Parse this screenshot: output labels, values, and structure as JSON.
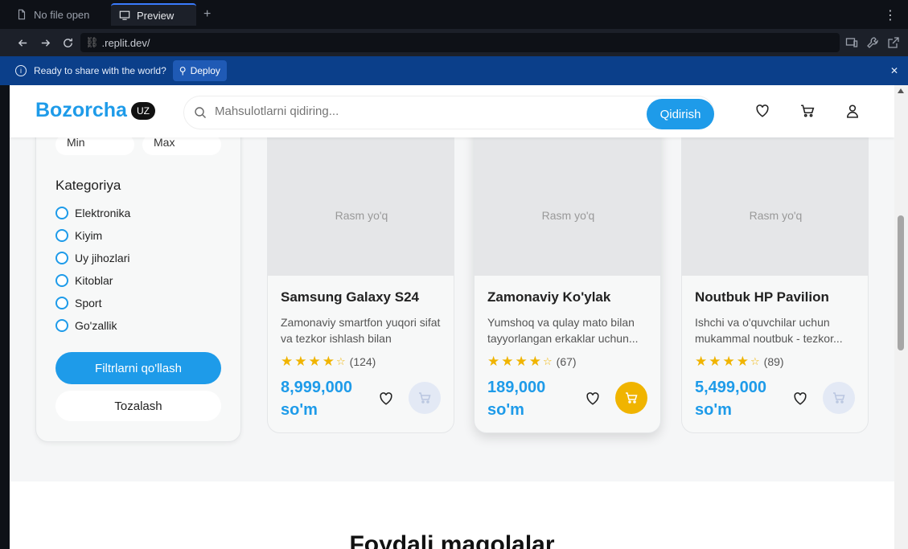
{
  "browser": {
    "tabs": [
      {
        "label": "No file open"
      },
      {
        "label": "Preview"
      }
    ],
    "url": ".replit.dev/"
  },
  "deploy_bar": {
    "message": "Ready to share with the world?",
    "button": "Deploy"
  },
  "header": {
    "logo": "Bozorcha",
    "lang": "UZ",
    "search_placeholder": "Mahsulotlarni qidiring...",
    "search_button": "Qidirish"
  },
  "filters": {
    "min_placeholder": "Min",
    "max_placeholder": "Max",
    "category_title": "Kategoriya",
    "categories": [
      "Elektronika",
      "Kiyim",
      "Uy jihozlari",
      "Kitoblar",
      "Sport",
      "Go'zallik"
    ],
    "apply": "Filtrlarni qo'llash",
    "clear": "Tozalash"
  },
  "products": [
    {
      "image_text": "Rasm yo'q",
      "title": "Samsung Galaxy S24",
      "desc": "Zamonaviy smartfon yuqori sifat va tezkor ishlash bilan",
      "rating_count": "(124)",
      "price": "8,999,000 so'm"
    },
    {
      "image_text": "Rasm yo'q",
      "title": "Zamonaviy Ko'ylak",
      "desc": "Yumshoq va qulay mato bilan tayyorlangan erkaklar uchun...",
      "rating_count": "(67)",
      "price": "189,000 so'm"
    },
    {
      "image_text": "Rasm yo'q",
      "title": "Noutbuk HP Pavilion",
      "desc": "Ishchi va o'quvchilar uchun mukammal noutbuk - tezkor...",
      "rating_count": "(89)",
      "price": "5,499,000 so'm"
    }
  ],
  "articles_title": "Foydali maqolalar"
}
